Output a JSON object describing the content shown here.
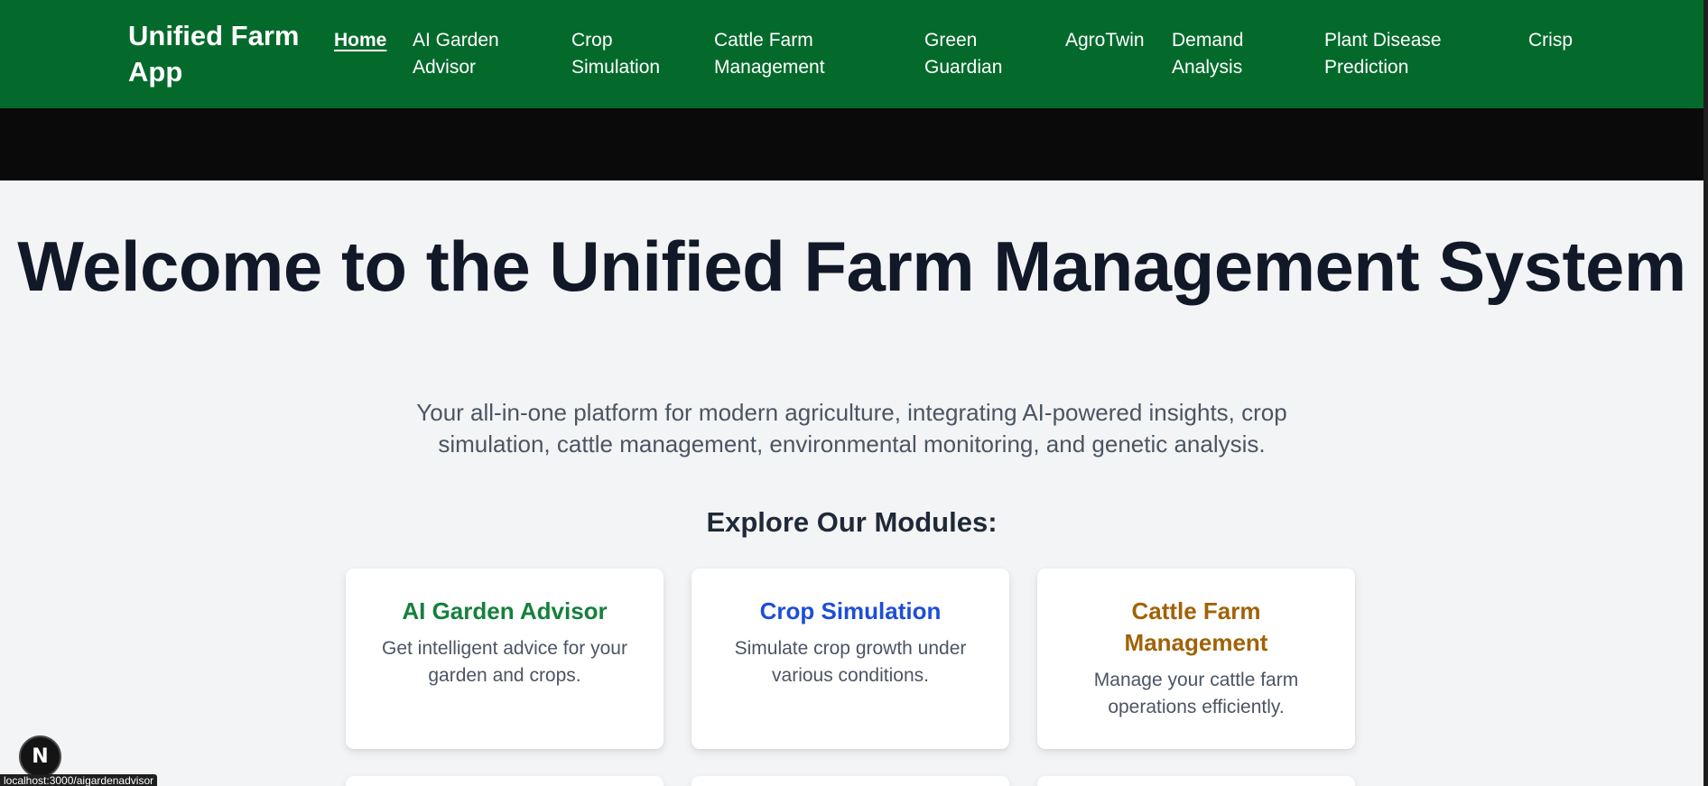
{
  "navbar": {
    "brand": "Unified Farm App",
    "links": [
      {
        "label": "Home"
      },
      {
        "label": "AI Garden Advisor"
      },
      {
        "label": "Crop Simulation"
      },
      {
        "label": "Cattle Farm Management"
      },
      {
        "label": "Green Guardian"
      },
      {
        "label": "AgroTwin"
      },
      {
        "label": "Demand Analysis"
      },
      {
        "label": "Plant Disease Prediction"
      },
      {
        "label": "Crisp"
      }
    ],
    "background_color": "#046a2c"
  },
  "hero": {
    "title": "Welcome to the Unified Farm Management System",
    "subtitle": "Your all-in-one platform for modern agriculture, integrating AI-powered insights, crop simulation, cattle management, environmental monitoring, and genetic analysis."
  },
  "modules": {
    "heading": "Explore Our Modules:",
    "cards": [
      {
        "title": "AI Garden Advisor",
        "description": "Get intelligent advice for your garden and crops.",
        "color": "#15803d"
      },
      {
        "title": "Crop Simulation",
        "description": "Simulate crop growth under various conditions.",
        "color": "#1d4ed8"
      },
      {
        "title": "Cattle Farm Management",
        "description": "Manage your cattle farm operations efficiently.",
        "color": "#a16207"
      }
    ]
  },
  "dev_badge": {
    "label": "N"
  },
  "status_bar": {
    "url": "localhost:3000/aigardenadvisor"
  }
}
